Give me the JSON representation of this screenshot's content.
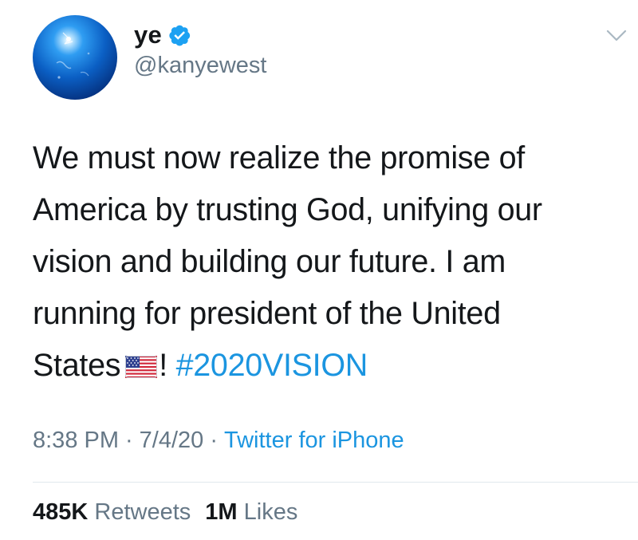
{
  "author": {
    "display_name": "ye",
    "handle": "@kanyewest",
    "verified_icon": "verified-badge-icon",
    "avatar_icon": "blue-planet-avatar"
  },
  "header": {
    "menu_icon": "chevron-down-icon"
  },
  "tweet": {
    "lines": [
      "We must now realize the promise of",
      "America by trusting God, unifying our",
      "vision and building our future. I am",
      "running for president of the United"
    ],
    "last_line_prefix": "States",
    "flag_icon": "us-flag-emoji",
    "last_line_suffix": "!",
    "hashtag": "#2020VISION"
  },
  "meta": {
    "time": "8:38 PM",
    "separator": "·",
    "date": "7/4/20",
    "source": "Twitter for iPhone"
  },
  "stats": {
    "retweets_count": "485K",
    "retweets_label": "Retweets",
    "likes_count": "1M",
    "likes_label": "Likes"
  },
  "colors": {
    "text": "#14171a",
    "secondary": "#657786",
    "link": "#1b95e0",
    "divider": "#e1e8ed"
  }
}
